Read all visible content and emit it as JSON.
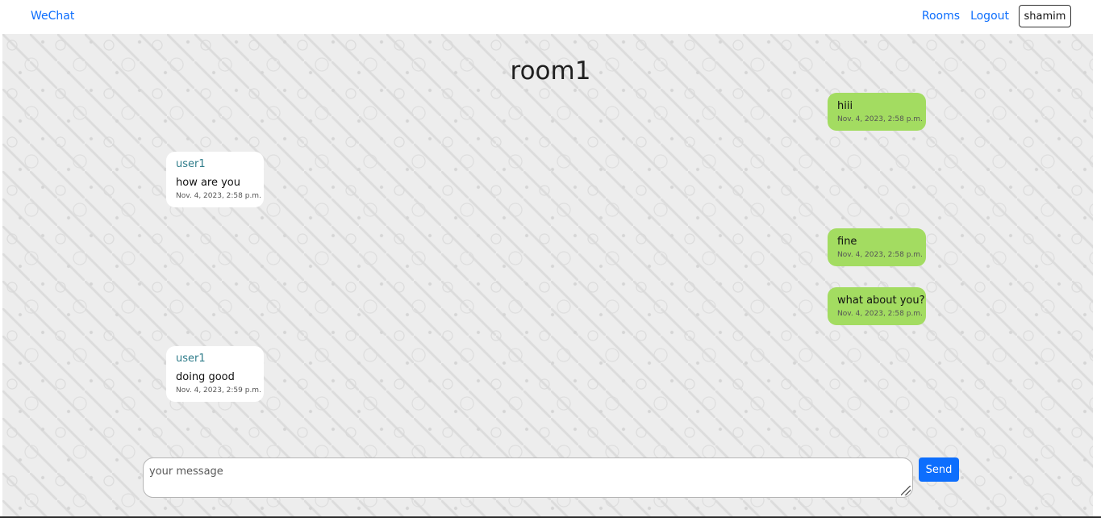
{
  "nav": {
    "brand": "WeChat",
    "links": [
      "Rooms",
      "Logout"
    ],
    "username": "shamim"
  },
  "room": {
    "title": "room1"
  },
  "messages": [
    {
      "direction": "out",
      "text": "hiii",
      "time": "Nov. 4, 2023, 2:58 p.m."
    },
    {
      "direction": "in",
      "sender": "user1",
      "text": "how are you",
      "time": "Nov. 4, 2023, 2:58 p.m."
    },
    {
      "direction": "out",
      "text": "fine",
      "time": "Nov. 4, 2023, 2:58 p.m."
    },
    {
      "direction": "out",
      "text": "what about you?",
      "time": "Nov. 4, 2023, 2:58 p.m."
    },
    {
      "direction": "in",
      "sender": "user1",
      "text": "doing good",
      "time": "Nov. 4, 2023, 2:59 p.m."
    }
  ],
  "composer": {
    "placeholder": "your message",
    "value": "",
    "send_label": "Send"
  },
  "colors": {
    "link": "#0d6efd",
    "outgoing_bubble": "#a3dc61",
    "incoming_bubble": "#ffffff",
    "sender_name": "#2f7c8a",
    "send_button": "#0d6efd"
  }
}
